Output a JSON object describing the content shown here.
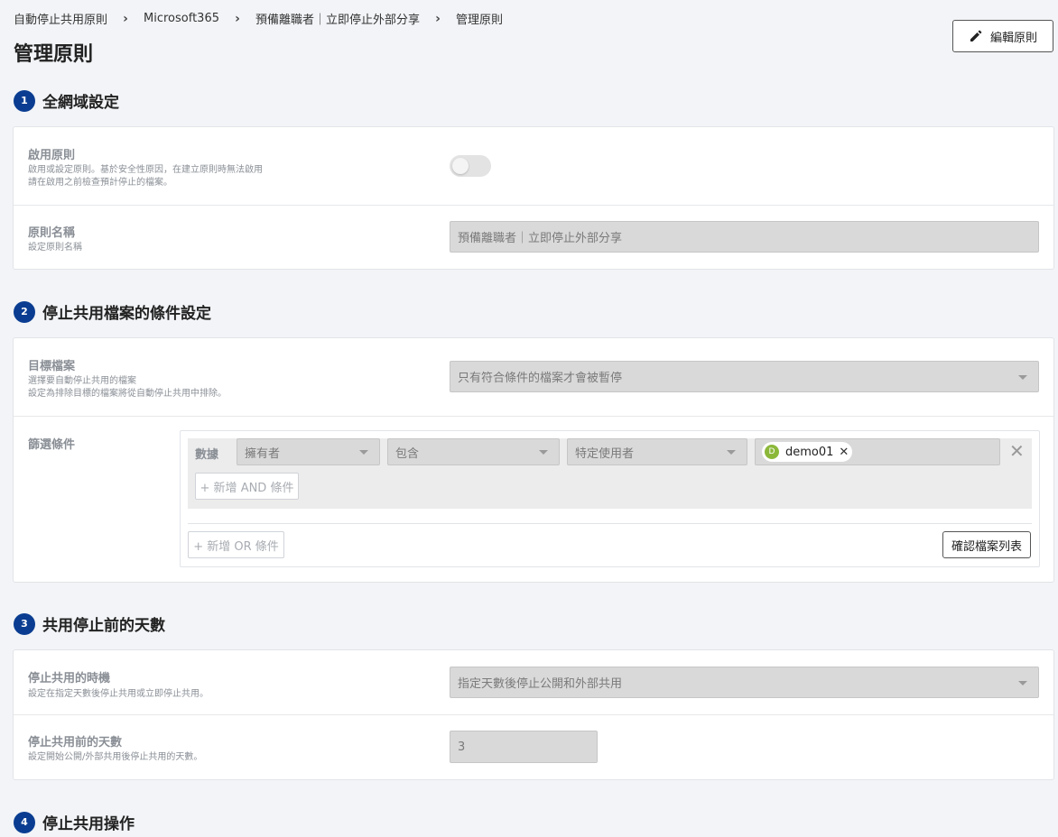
{
  "breadcrumb": [
    "自動停止共用原則",
    "Microsoft365",
    "預備離職者｜立即停止外部分享",
    "管理原則"
  ],
  "page_title": "管理原則",
  "edit_button": "編輯原則",
  "sections": [
    {
      "num": "1",
      "title": "全網域設定"
    },
    {
      "num": "2",
      "title": "停止共用檔案的條件設定"
    },
    {
      "num": "3",
      "title": "共用停止前的天數"
    },
    {
      "num": "4",
      "title": "停止共用操作"
    }
  ],
  "global": {
    "enable_label": "啟用原則",
    "enable_desc1": "啟用或設定原則。基於安全性原因，在建立原則時無法啟用",
    "enable_desc2": "請在啟用之前檢查預計停止的檔案。",
    "enable_state": "off",
    "name_label": "原則名稱",
    "name_desc": "設定原則名稱",
    "name_value": "預備離職者｜立即停止外部分享"
  },
  "conditions": {
    "target_label": "目標檔案",
    "target_desc1": "選擇要自動停止共用的檔案",
    "target_desc2": "設定為排除目標的檔案將從自動停止共用中排除。",
    "target_value": "只有符合條件的檔案才會被暫停",
    "filter_label": "篩選條件",
    "row_label": "數據",
    "field": "擁有者",
    "operator": "包含",
    "value_type": "特定使用者",
    "tag_initial": "D",
    "tag_text": "demo01",
    "add_and": "+ 新增 AND 條件",
    "add_or": "+ 新增 OR 條件",
    "confirm": "確認檔案列表"
  },
  "days": {
    "timing_label": "停止共用的時機",
    "timing_desc": "設定在指定天數後停止共用或立即停止共用。",
    "timing_value": "指定天數後停止公開和外部共用",
    "days_label": "停止共用前的天數",
    "days_desc": "設定開始公開/外部共用後停止共用的天數。",
    "days_value": "3"
  },
  "colors": {
    "accent": "#0a3d91",
    "avatar": "#8cb83a",
    "background": "#f2f4f7"
  }
}
